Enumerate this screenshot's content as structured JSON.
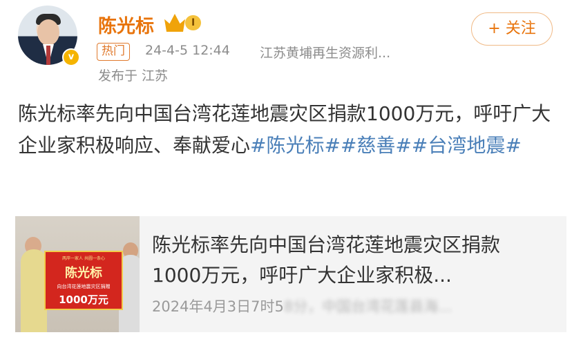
{
  "author": {
    "name": "陈光标",
    "level_badge": "I",
    "verified_icon": "v-badge-icon",
    "crown_icon": "crown-icon"
  },
  "follow_button": {
    "label": "+ 关注"
  },
  "meta": {
    "hot_tag": "热门",
    "time": "24-4-5 12:44",
    "source": "江苏黄埔再生资源利...",
    "location": "发布于 江苏"
  },
  "post": {
    "text": "陈光标率先向中国台湾花莲地震灾区捐款1000万元，呼吁广大企业家积极响应、奉献爱心",
    "tags": [
      "#陈光标#",
      "#慈善#",
      "#台湾地震#"
    ]
  },
  "link_card": {
    "title": "陈光标率先向中国台湾花莲地震灾区捐款1000万元，呼吁广大企业家积极...",
    "date_visible": "2024年4月3日7时5",
    "date_blurred": "8分，中国台湾花莲县海...",
    "image": {
      "banner_top": "两岸一家人 共圆一条心",
      "banner_name": "陈光标",
      "banner_desc": "向台湾花莲地震灾区捐赠",
      "banner_amount": "1000万元"
    }
  },
  "colors": {
    "username": "#e8740c",
    "hashtag": "#4a7fb8",
    "meta": "#8c8c8c"
  }
}
